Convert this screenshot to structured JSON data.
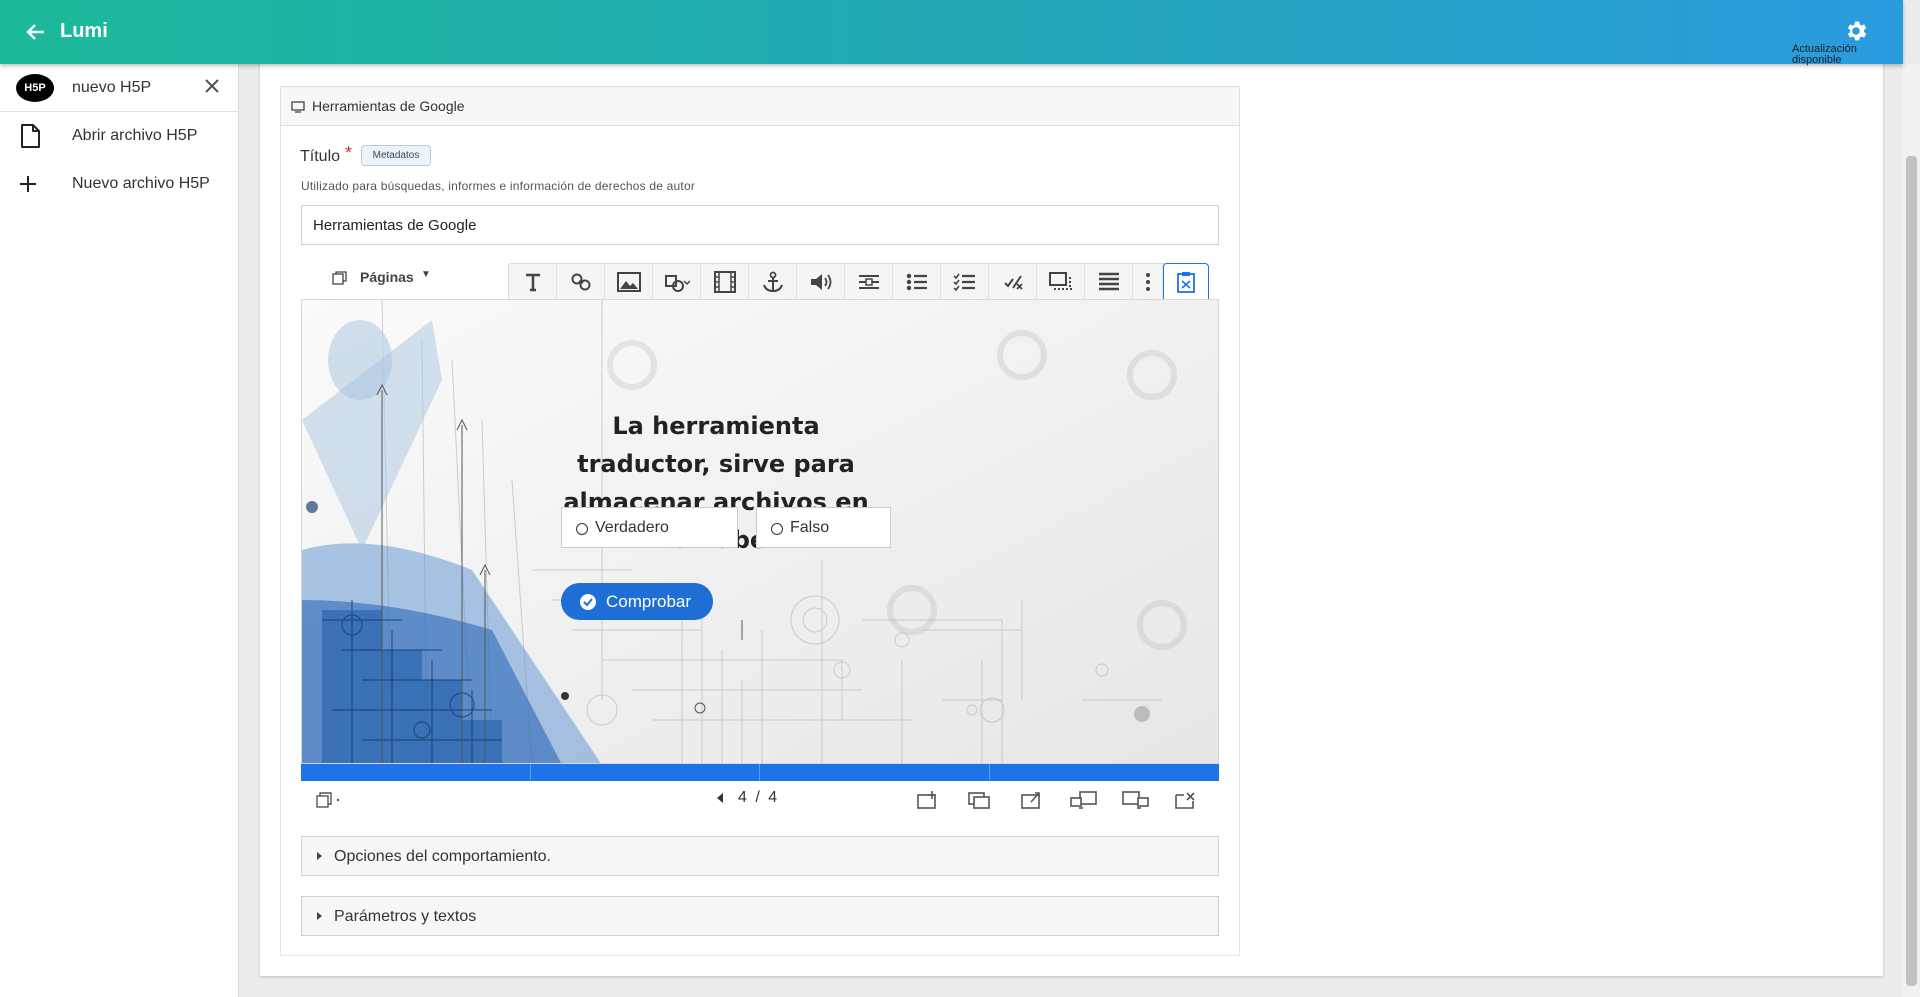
{
  "app": {
    "title": "Lumi",
    "update_label_line1": "Actualización",
    "update_label_line2": "disponible",
    "accent": "#1cb99a",
    "accent2": "#2b9be0"
  },
  "sidebar": {
    "items": [
      {
        "label": "nuevo H5P",
        "icon": "h5p-icon",
        "badge": "H5P"
      },
      {
        "label": "Abrir archivo H5P",
        "icon": "file-icon"
      },
      {
        "label": "Nuevo archivo H5P",
        "icon": "plus-icon"
      }
    ]
  },
  "editor": {
    "section_title": "Herramientas de Google",
    "title_label": "Título",
    "required_mark": "*",
    "metadata_button": "Metadatos",
    "title_description": "Utilizado para búsquedas, informes e información de derechos de autor",
    "title_value": "Herramientas de Google",
    "pages_dropdown": "Páginas",
    "slide": {
      "question": "La herramienta traductor, sirve para almacenar archivos en la nube",
      "options": [
        "Verdadero",
        "Falso"
      ],
      "check_button": "Comprobar",
      "progress": 1.0,
      "accent": "#1f6ed6"
    },
    "navigation": {
      "current": "4",
      "separator": "/",
      "total": "4"
    },
    "groups": [
      "Opciones del comportamiento.",
      "Parámetros y textos"
    ]
  }
}
